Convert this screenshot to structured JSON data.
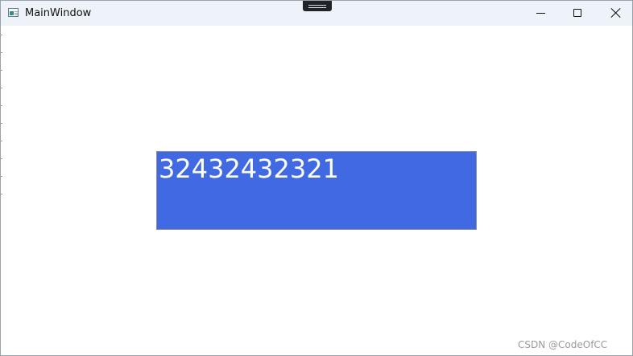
{
  "window": {
    "title": "MainWindow"
  },
  "titlebar": {
    "app_icon": "window-icon",
    "drag_handle_icon": "drag-handle-icon",
    "buttons": [
      {
        "name": "minimize",
        "icon": "minimize-icon"
      },
      {
        "name": "maximize",
        "icon": "maximize-icon"
      },
      {
        "name": "close",
        "icon": "close-icon"
      }
    ]
  },
  "content": {
    "textbox": {
      "value": "32432432321",
      "background_color": "#4169e1",
      "text_color": "#ffffff"
    },
    "watermark": "CSDN @CodeOfCC"
  }
}
